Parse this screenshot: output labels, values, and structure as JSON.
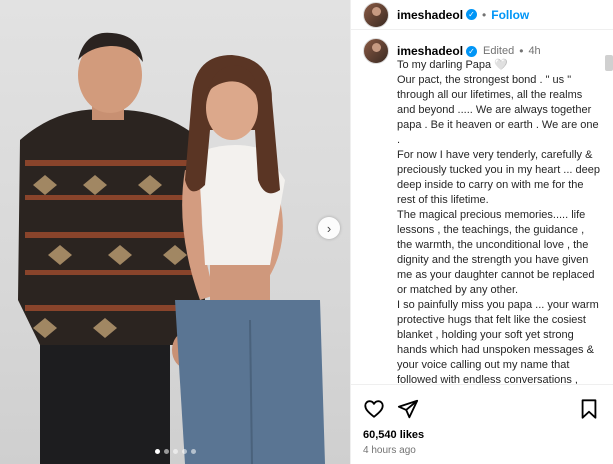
{
  "post": {
    "username": "imeshadeol",
    "follow_label": "Follow",
    "separator": "•",
    "verified_mark": "✓",
    "edited_label": "Edited",
    "time_short": "4h",
    "caption": "To my darling Papa 🤍\nOur pact, the strongest bond . \" us \" through all our lifetimes, all the realms and beyond ..... We are always together papa . Be it heaven or earth . We are one .\nFor now I have very tenderly, carefully & preciously tucked you in my heart ... deep deep inside to carry on with me for the rest of this lifetime.\nThe magical precious memories..... life lessons , the teachings, the guidance , the warmth, the unconditional love , the dignity and the strength you have given me as your daughter cannot be replaced or matched by any other.\nI so painfully miss you papa ... your warm protective hugs that felt like the cosiest  blanket , holding your soft yet strong hands which had unspoken messages & your voice calling out my name that  followed with endless conversations , laughter & shayaris",
    "likes": "60,540 likes",
    "posted_time": "4 hours ago"
  },
  "media": {
    "carousel_dots": 5,
    "active_dot": 0,
    "next_glyph": "›"
  },
  "icons": {
    "heart": "heart-icon",
    "share": "share-icon",
    "save": "bookmark-icon",
    "next": "chevron-right-icon"
  },
  "colors": {
    "accent": "#0095f6",
    "muted": "#737373",
    "border": "#efefef"
  }
}
